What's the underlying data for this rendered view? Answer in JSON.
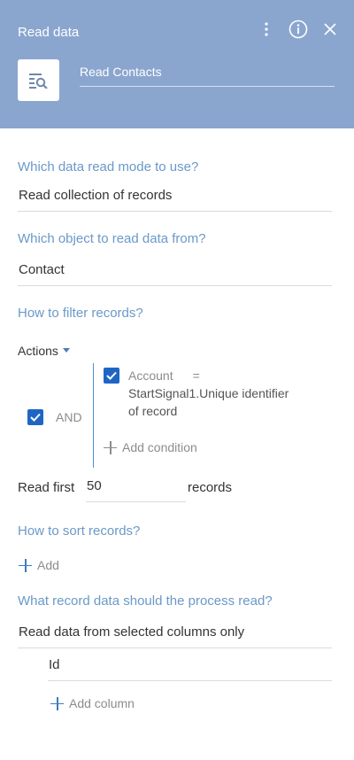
{
  "header": {
    "title": "Read data",
    "element_name": "Read Contacts",
    "icons": [
      "more-vertical-icon",
      "info-icon",
      "close-icon",
      "read-data-icon"
    ]
  },
  "read_mode": {
    "question": "Which data read mode to use?",
    "value": "Read collection of records"
  },
  "object": {
    "question": "Which object to read data from?",
    "value": "Contact"
  },
  "filter": {
    "question": "How to filter records?",
    "actions_label": "Actions",
    "group_operator": "AND",
    "condition": {
      "column": "Account",
      "operator": "=",
      "value_line1": "StartSignal1.Unique identifier",
      "value_line2": "of record"
    },
    "add_condition_label": "Add condition"
  },
  "read_first": {
    "label": "Read first",
    "value": "50",
    "suffix": "records"
  },
  "sort": {
    "question": "How to sort records?",
    "add_label": "Add"
  },
  "record_data": {
    "question": "What record data should the process read?",
    "value": "Read data from selected columns only",
    "columns": [
      "Id"
    ],
    "add_column_label": "Add column"
  },
  "colors": {
    "header_bg": "#8aa6cf",
    "question": "#6a99c9",
    "checkbox": "#1f66c4",
    "group_line": "#4a8fd6"
  }
}
